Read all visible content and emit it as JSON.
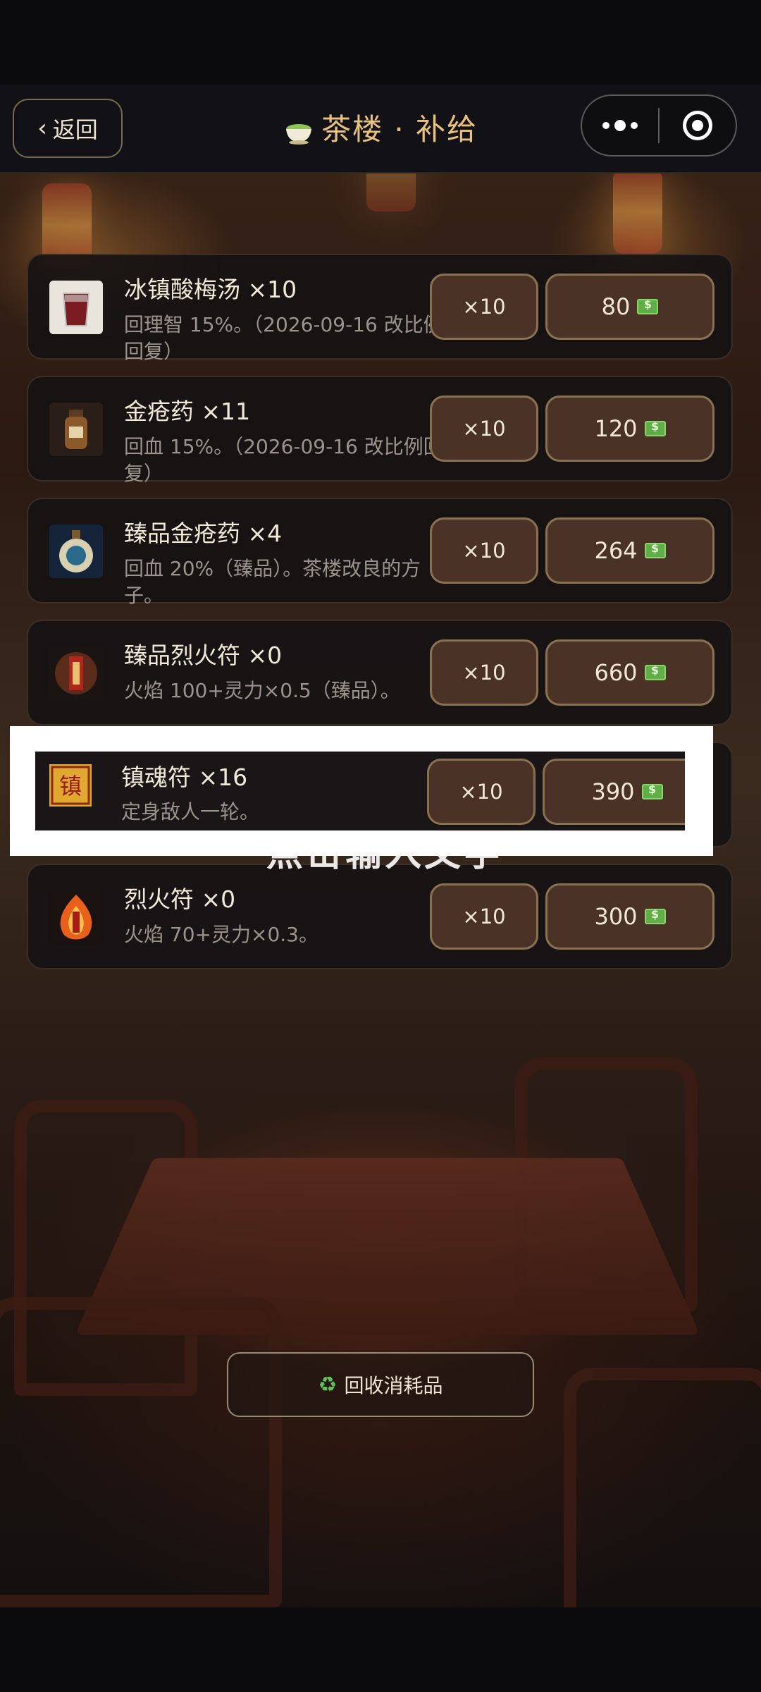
{
  "header": {
    "back_label": "返回",
    "title": "茶楼 · 补给"
  },
  "items": [
    {
      "name": "冰镇酸梅汤 ×10",
      "desc": "回理智 15%。（2026-09-16 改比例回复）",
      "qty_label": "×10",
      "price": "80",
      "icon": "plum-drink-icon"
    },
    {
      "name": "金疮药 ×11",
      "desc": "回血 15%。（2026-09-16 改比例回复）",
      "qty_label": "×10",
      "price": "120",
      "icon": "medicine-bottle-icon"
    },
    {
      "name": "臻品金疮药 ×4",
      "desc": "回血 20%（臻品）。茶楼改良的方子。",
      "qty_label": "×10",
      "price": "264",
      "icon": "premium-medicine-icon"
    },
    {
      "name": "臻品烈火符 ×0",
      "desc": "火焰 100+灵力×0.5（臻品）。",
      "qty_label": "×10",
      "price": "660",
      "icon": "premium-fire-talisman-icon"
    },
    {
      "name": "镇魂符 ×16",
      "desc": "定身敌人一轮。",
      "qty_label": "×10",
      "price": "390",
      "icon": "soul-suppress-talisman-icon"
    },
    {
      "name": "烈火符 ×0",
      "desc": "火焰 70+灵力×0.3。",
      "qty_label": "×10",
      "price": "300",
      "icon": "fire-talisman-icon"
    }
  ],
  "overlay_text": "点击输入文字",
  "recycle_label": "回收消耗品",
  "colors": {
    "accent_gold": "#e9c27e",
    "button_bg": "#4a3326",
    "button_border": "#8a7250"
  }
}
